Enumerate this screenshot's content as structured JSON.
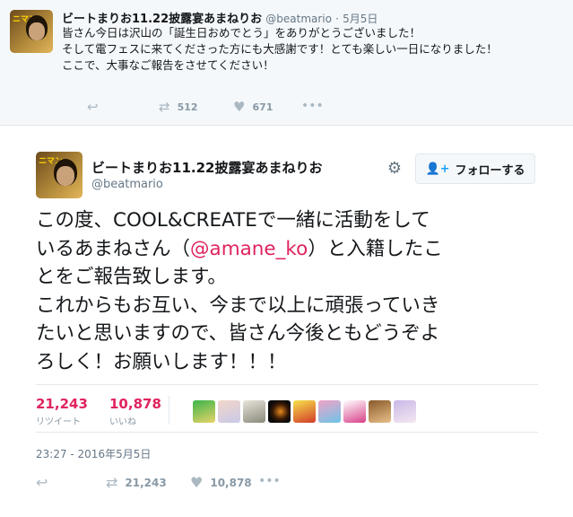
{
  "parent_tweet": {
    "name": "ビートまりお11.22披露宴あまねりお",
    "handle": "@beatmario",
    "separator": "·",
    "date": "5月5日",
    "text": "皆さん今日は沢山の「誕生日おめでとう」をありがとうございました！\nそして電フェスに来てくださった方にも大感謝です！とても楽しい一日になりました！\nここで、大事なご報告をさせてください！",
    "retweets": "512",
    "likes": "671",
    "avatar_caption": "ニマン"
  },
  "main_tweet": {
    "name": "ビートまりお11.22披露宴あまねりお",
    "handle": "@beatmario",
    "follow_label": "フォローする",
    "text_lines": [
      "この度、COOL&CREATEで一緒に活動をして",
      "いるあまねさん（",
      "@amane_ko",
      "）と入籍したこ",
      "とをご報告致します。",
      "これからもお互い、今まで以上に頑張っていき",
      "たいと思いますので、皆さん今後ともどうぞよ",
      "ろしく！お願いします！！！"
    ],
    "retweets_count": "21,243",
    "retweets_label": "リツイート",
    "likes_count": "10,878",
    "likes_label": "いいね",
    "timestamp": "23:27 - 2016年5月5日",
    "action_retweets": "21,243",
    "action_likes": "10,878",
    "avatar_caption": "ニマン"
  },
  "icons": {
    "reply": "reply-icon",
    "retweet": "retweet-icon",
    "like": "heart-icon",
    "more": "more-icon",
    "gear": "gear-icon",
    "follow": "follow-person-icon"
  },
  "colors": {
    "accent_pink": "#e0245e",
    "link_blue": "#1da1f2",
    "muted": "#657786"
  }
}
